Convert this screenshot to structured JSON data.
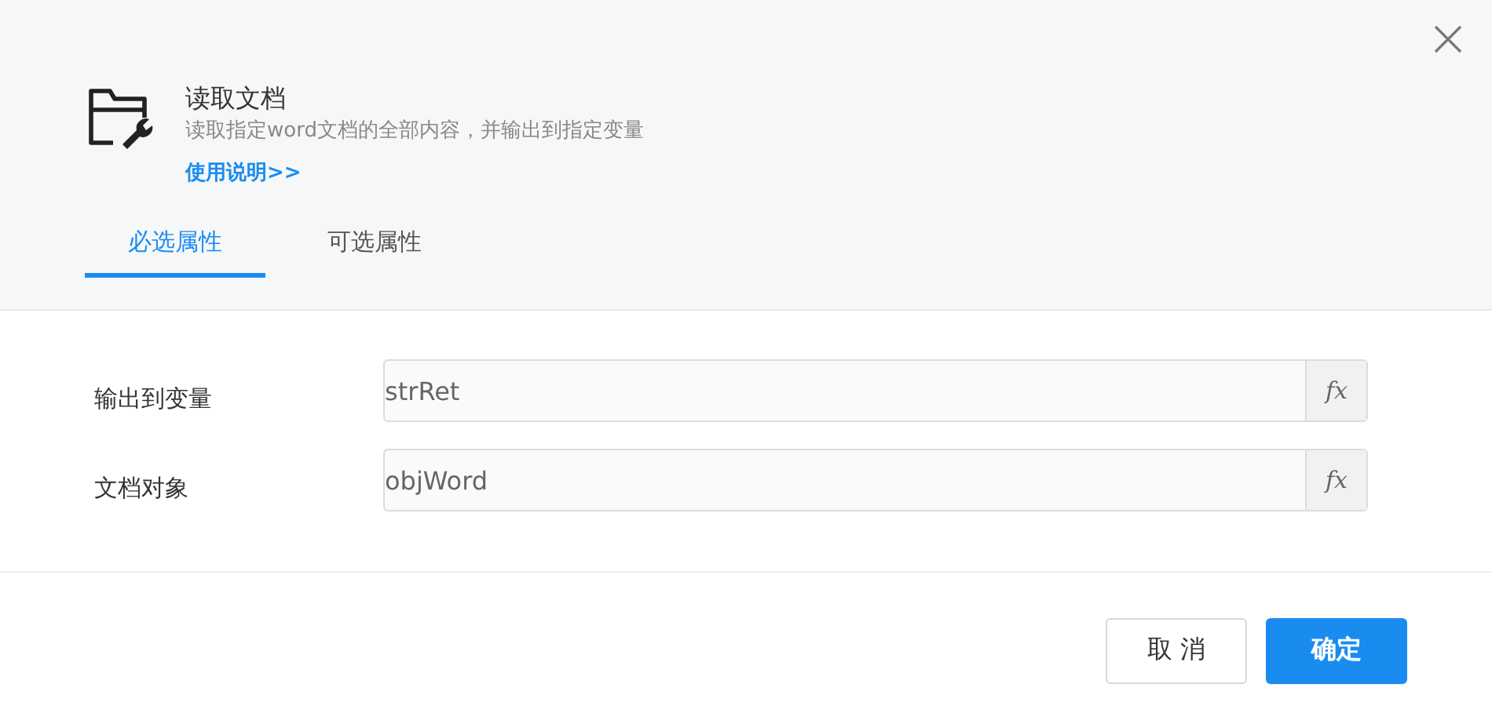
{
  "dialog": {
    "title": "读取文档",
    "description": "读取指定word文档的全部内容，并输出到指定变量",
    "help_link": "使用说明>>"
  },
  "tabs": [
    {
      "label": "必选属性",
      "selected": true
    },
    {
      "label": "可选属性",
      "selected": false
    }
  ],
  "fields": [
    {
      "label": "输出到变量",
      "value": "strRet",
      "button": "fx"
    },
    {
      "label": "文档对象",
      "value": "objWord",
      "button": "fx"
    }
  ],
  "buttons": [
    {
      "label": "取 消",
      "kind": "secondary"
    },
    {
      "label": "确定",
      "kind": "primary"
    }
  ]
}
